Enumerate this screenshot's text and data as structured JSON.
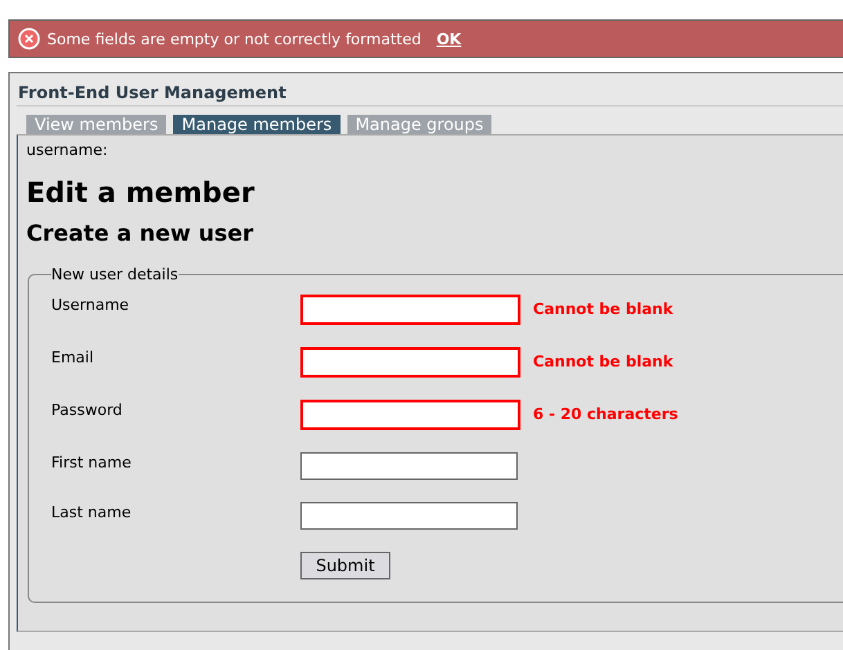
{
  "alert": {
    "message": "Some fields are empty or not correctly formatted",
    "action": "OK"
  },
  "panel": {
    "title": "Front-End User Management"
  },
  "tabs": [
    {
      "label": "View members",
      "selected": false
    },
    {
      "label": "Manage members",
      "selected": true
    },
    {
      "label": "Manage groups",
      "selected": false
    }
  ],
  "username_label": "username:",
  "heading": "Edit a member",
  "subheading": "Create a new user",
  "fieldset": {
    "legend": "New user details",
    "fields": [
      {
        "label": "Username",
        "invalid": true,
        "error": "Cannot be blank"
      },
      {
        "label": "Email",
        "invalid": true,
        "error": "Cannot be blank"
      },
      {
        "label": "Password",
        "invalid": true,
        "error": "6 - 20 characters"
      },
      {
        "label": "First name",
        "invalid": false
      },
      {
        "label": "Last name",
        "invalid": false
      }
    ],
    "submit": "Submit"
  }
}
